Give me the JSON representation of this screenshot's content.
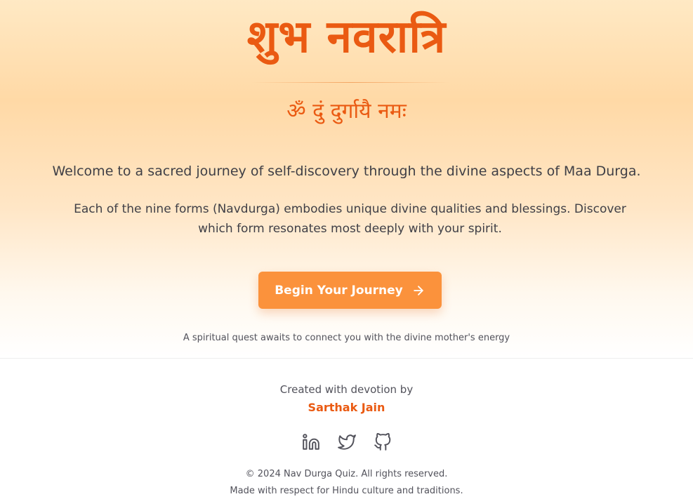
{
  "hero": {
    "title": "शुभ नवरात्रि",
    "mantra": "ॐ दुं दुर्गायै नमः",
    "welcome": "Welcome to a sacred journey of self-discovery through the divine aspects of Maa Durga.",
    "description": "Each of the nine forms (Navdurga) embodies unique divine qualities and blessings. Discover which form resonates most deeply with your spirit.",
    "begin_button_label": "Begin Your Journey",
    "begin_button_icon": "arrow-right-icon",
    "quest_note": "A spiritual quest awaits to connect you with the divine mother's energy"
  },
  "footer": {
    "created_by_label": "Created with devotion by",
    "author": "Sarthak Jain",
    "socials": [
      {
        "icon": "linkedin-icon"
      },
      {
        "icon": "twitter-icon"
      },
      {
        "icon": "github-icon"
      }
    ],
    "copyright": "© 2024 Nav Durga Quiz. All rights reserved.",
    "respect_note": "Made with respect for Hindu culture and traditions."
  },
  "colors": {
    "accent": "#ea5a12",
    "button": "#fb923c",
    "text": "#3f3f46",
    "muted": "#52525b"
  }
}
